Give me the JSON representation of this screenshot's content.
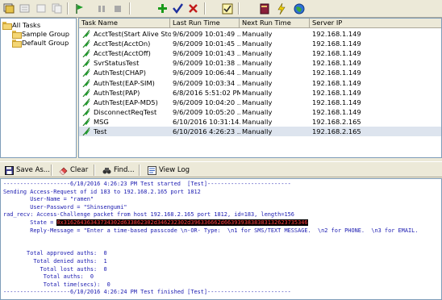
{
  "toolbar": {
    "buttons": [
      "all-tasks-icon",
      "properties-icon",
      "cut-icon",
      "copy-icon",
      "run-icon",
      "pause-icon",
      "stop-icon",
      "add-icon",
      "check-icon",
      "delete-icon",
      "schedule-icon",
      "book-icon",
      "lightning-icon",
      "globe-icon"
    ]
  },
  "tree": {
    "root": "All Tasks",
    "items": [
      "Sample Group",
      "Default Group"
    ]
  },
  "grid": {
    "columns": [
      "Task Name",
      "Last Run Time",
      "Next Run Time",
      "Server IP"
    ],
    "rows": [
      {
        "name": "AcctTest(Start Alive Stop)",
        "last": "9/6/2009 10:01:49 ...",
        "next": "Manually",
        "ip": "192.168.1.149"
      },
      {
        "name": "AcctTest(AcctOn)",
        "last": "9/6/2009 10:01:45 ...",
        "next": "Manually",
        "ip": "192.168.1.149"
      },
      {
        "name": "AcctTest(AcctOff)",
        "last": "9/6/2009 10:01:43 ...",
        "next": "Manually",
        "ip": "192.168.1.149"
      },
      {
        "name": "SvrStatusTest",
        "last": "9/6/2009 10:01:38 ...",
        "next": "Manually",
        "ip": "192.168.1.149"
      },
      {
        "name": "AuthTest(CHAP)",
        "last": "9/6/2009 10:06:44 ...",
        "next": "Manually",
        "ip": "192.168.1.149"
      },
      {
        "name": "AuthTest(EAP-SIM)",
        "last": "9/6/2009 10:03:34 ...",
        "next": "Manually",
        "ip": "192.168.1.149"
      },
      {
        "name": "AuthTest(PAP)",
        "last": "6/8/2016 5:51:02 PM",
        "next": "Manually",
        "ip": "192.168.1.149"
      },
      {
        "name": "AuthTest(EAP-MD5)",
        "last": "9/6/2009 10:04:20 ...",
        "next": "Manually",
        "ip": "192.168.1.149"
      },
      {
        "name": "DisconnectReqTest",
        "last": "9/6/2009 10:05:20 ...",
        "next": "Manually",
        "ip": "192.168.1.149"
      },
      {
        "name": "MSG",
        "last": "6/10/2016 10:31:14...",
        "next": "Manually",
        "ip": "192.168.2.165"
      },
      {
        "name": "Test",
        "last": "6/10/2016 4:26:23 ...",
        "next": "Manually",
        "ip": "192.168.2.165"
      }
    ]
  },
  "logbar": {
    "save_as": "Save As...",
    "clear": "Clear",
    "find": "Find...",
    "view_log": "View Log"
  },
  "log": {
    "lines": [
      "--------------------6/10/2016 4:26:23 PM Test started  [Test]-------------------------",
      "Sending Access-Request of id 183 to 192.168.2.165 port 1812",
      "        User-Name = \"ramen\"",
      "        User-Password = \"Shinsengumi\"",
      "rad_recv: Access-Challenge packet from host 192.168.2.165 port 1812, id=183, length=156",
      "        State = ",
      "        Reply-Message = \"Enter a time-based passcode \\n-OR- Type:  \\n1 for SMS/TEXT MESSAGE.  \\n2 for PHONE.  \\n3 for EMAIL.",
      "",
      "",
      "       Total approved auths:  0",
      "         Total denied auths:  1",
      "           Total lost auths:  0",
      "            Total auths:  0",
      "            Total time(secs):  0",
      "--------------------6/10/2016 4:26:24 PM Test finished [Test]-------------------------"
    ],
    "state_value": "0x31626436343734302d633862302d346232302d396336662d6639393838383132623735346"
  },
  "colors": {
    "log_text": "#1a1ab0",
    "state_highlight_bg": "#000000",
    "state_highlight_fg": "#ff4040",
    "selected_row": "#dde4ee",
    "task_icon_green": "#1e9e2e"
  }
}
